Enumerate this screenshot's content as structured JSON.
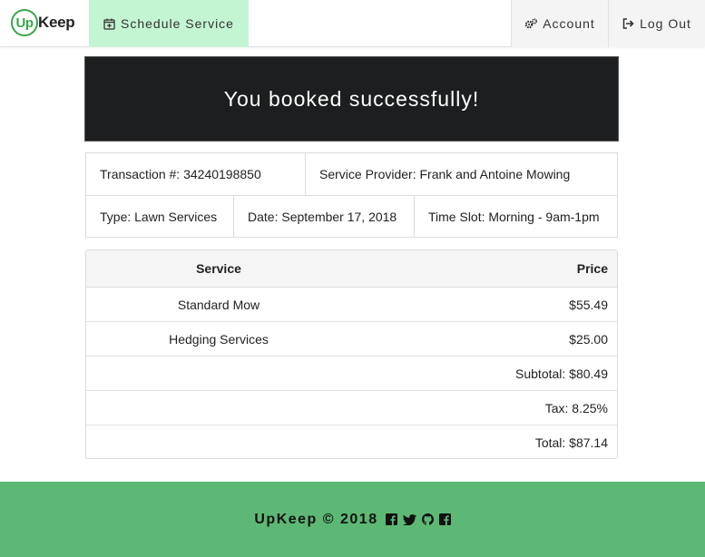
{
  "navbar": {
    "brand_circle": "Up",
    "brand_rest": "Keep",
    "schedule_label": "Schedule Service",
    "account_label": "Account",
    "logout_label": "Log Out"
  },
  "banner": {
    "title": "You booked successfully!"
  },
  "details": {
    "transaction": "Transaction #: 34240198850",
    "provider": "Service Provider: Frank and Antoine Mowing",
    "type": "Type: Lawn Services",
    "date": "Date: September 17, 2018",
    "time_slot": "Time Slot: Morning - 9am-1pm"
  },
  "table": {
    "header_service": "Service",
    "header_price": "Price",
    "rows": [
      {
        "service": "Standard Mow",
        "price": "$55.49"
      },
      {
        "service": "Hedging Services",
        "price": "$25.00"
      }
    ],
    "subtotal": "Subtotal: $80.49",
    "tax": "Tax: 8.25%",
    "total": "Total: $87.14"
  },
  "footer": {
    "text": "UpKeep © 2018",
    "icons": [
      "facebook-icon",
      "twitter-icon",
      "github-icon",
      "facebook-icon"
    ]
  },
  "colors": {
    "brand_green": "#3aa64a",
    "nav_active": "#c4f5d2",
    "banner_bg": "#1d1e1f",
    "footer_bg": "#5cb874"
  }
}
